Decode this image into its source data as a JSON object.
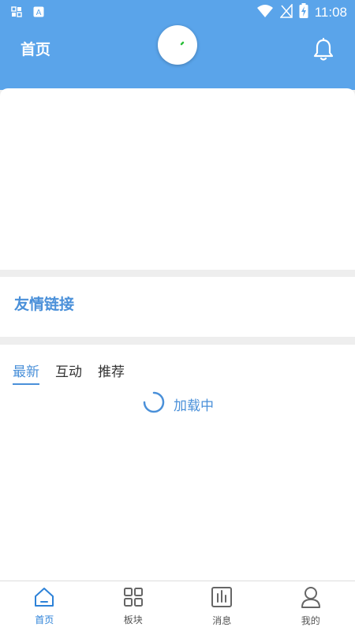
{
  "status_bar": {
    "time": "11:08",
    "icons": [
      "grid-status-icon",
      "a-status-icon",
      "wifi-icon",
      "no-signal-icon",
      "battery-charging-icon"
    ]
  },
  "header": {
    "title": "首页",
    "notification_icon": "bell-icon",
    "avatar_icon": "avatar-icon"
  },
  "links_section": {
    "title": "友情链接"
  },
  "feed": {
    "tabs": [
      "最新",
      "互动",
      "推荐"
    ],
    "active_tab_index": 0,
    "loading_text": "加载中"
  },
  "bottom_nav": [
    {
      "label": "首页",
      "icon": "home-icon",
      "active": true
    },
    {
      "label": "板块",
      "icon": "grid-icon",
      "active": false
    },
    {
      "label": "消息",
      "icon": "message-icon",
      "active": false
    },
    {
      "label": "我的",
      "icon": "user-icon",
      "active": false
    }
  ],
  "colors": {
    "primary": "#5aa4ea",
    "accent": "#4a90d9",
    "background": "#eeeeee"
  }
}
